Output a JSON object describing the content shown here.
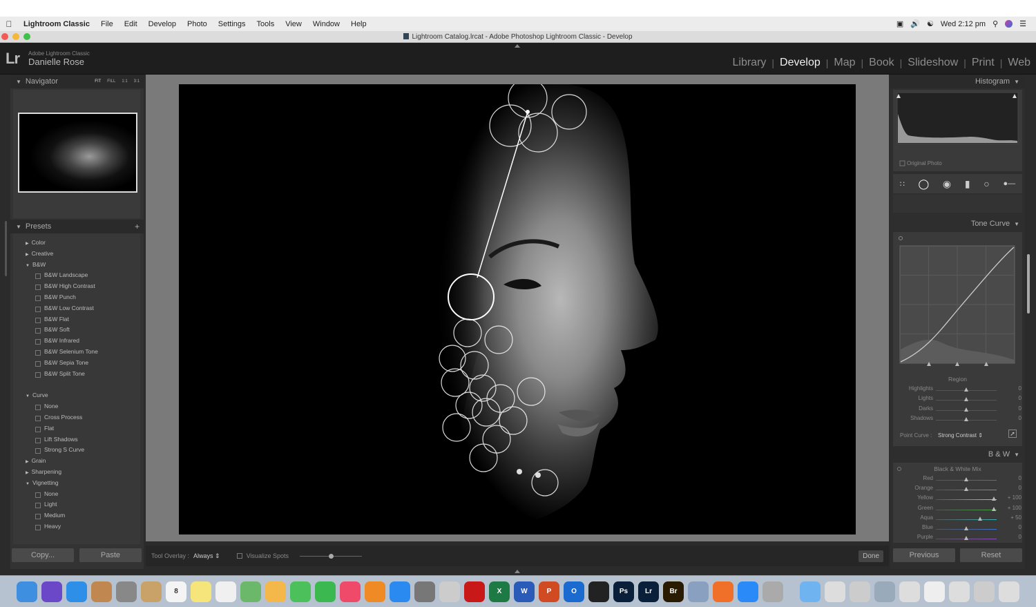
{
  "menubar": {
    "app": "Lightroom Classic",
    "items": [
      "File",
      "Edit",
      "Develop",
      "Photo",
      "Settings",
      "Tools",
      "View",
      "Window",
      "Help"
    ],
    "clock": "Wed 2:12 pm"
  },
  "window": {
    "title": "Lightroom Catalog.lrcat - Adobe Photoshop Lightroom Classic - Develop"
  },
  "identity": {
    "logo": "Lr",
    "product": "Adobe Lightroom Classic",
    "user": "Danielle Rose"
  },
  "modules": [
    "Library",
    "Develop",
    "Map",
    "Book",
    "Slideshow",
    "Print",
    "Web"
  ],
  "active_module": "Develop",
  "navigator": {
    "title": "Navigator",
    "zoom": [
      "FIT",
      "FILL",
      "1:1",
      "3:1"
    ]
  },
  "presets": {
    "title": "Presets",
    "items": [
      {
        "type": "fold",
        "label": "Color",
        "open": false
      },
      {
        "type": "fold",
        "label": "Creative",
        "open": false
      },
      {
        "type": "fold",
        "label": "B&W",
        "open": true
      },
      {
        "type": "item",
        "label": "B&W Landscape"
      },
      {
        "type": "item",
        "label": "B&W High Contrast"
      },
      {
        "type": "item",
        "label": "B&W Punch"
      },
      {
        "type": "item",
        "label": "B&W Low Contrast"
      },
      {
        "type": "item",
        "label": "B&W Flat"
      },
      {
        "type": "item",
        "label": "B&W Soft"
      },
      {
        "type": "item",
        "label": "B&W Infrared"
      },
      {
        "type": "item",
        "label": "B&W Selenium Tone"
      },
      {
        "type": "item",
        "label": "B&W Sepia Tone"
      },
      {
        "type": "item",
        "label": "B&W Split Tone"
      },
      {
        "type": "gap",
        "label": ""
      },
      {
        "type": "fold",
        "label": "Curve",
        "open": true
      },
      {
        "type": "item",
        "label": "None"
      },
      {
        "type": "item",
        "label": "Cross Process"
      },
      {
        "type": "item",
        "label": "Flat"
      },
      {
        "type": "item",
        "label": "Lift Shadows"
      },
      {
        "type": "item",
        "label": "Strong S Curve"
      },
      {
        "type": "fold",
        "label": "Grain",
        "open": false
      },
      {
        "type": "fold",
        "label": "Sharpening",
        "open": false
      },
      {
        "type": "fold",
        "label": "Vignetting",
        "open": true
      },
      {
        "type": "item",
        "label": "None"
      },
      {
        "type": "item",
        "label": "Light"
      },
      {
        "type": "item",
        "label": "Medium"
      },
      {
        "type": "item",
        "label": "Heavy"
      }
    ]
  },
  "left_buttons": {
    "copy": "Copy...",
    "paste": "Paste"
  },
  "toolbar": {
    "overlay_label": "Tool Overlay :",
    "overlay_value": "Always",
    "visualize": "Visualize Spots",
    "done": "Done",
    "visualize_level": 0.5
  },
  "histogram": {
    "title": "Histogram",
    "original": "Original Photo"
  },
  "tone_curve": {
    "title": "Tone Curve",
    "region": "Region",
    "sliders": [
      {
        "label": "Highlights",
        "value": "0",
        "level": 0.5
      },
      {
        "label": "Lights",
        "value": "0",
        "level": 0.5
      },
      {
        "label": "Darks",
        "value": "0",
        "level": 0.5
      },
      {
        "label": "Shadows",
        "value": "0",
        "level": 0.5
      }
    ],
    "point_curve_label": "Point Curve :",
    "point_curve_value": "Strong Contrast"
  },
  "bw": {
    "title": "B & W",
    "mix_title": "Black & White Mix",
    "sliders": [
      {
        "label": "Red",
        "value": "0",
        "color": "#c8453c",
        "level": 0.5
      },
      {
        "label": "Orange",
        "value": "0",
        "color": "#d07a30",
        "level": 0.5
      },
      {
        "label": "Yellow",
        "value": "+ 100",
        "color": "#d6c83a",
        "level": 0.96
      },
      {
        "label": "Green",
        "value": "+ 100",
        "color": "#48a848",
        "level": 0.96
      },
      {
        "label": "Aqua",
        "value": "+ 50",
        "color": "#3fb3b0",
        "level": 0.73
      },
      {
        "label": "Blue",
        "value": "0",
        "color": "#4170c8",
        "level": 0.5
      },
      {
        "label": "Purple",
        "value": "0",
        "color": "#8c4cc0",
        "level": 0.5
      }
    ]
  },
  "right_buttons": {
    "previous": "Previous",
    "reset": "Reset"
  },
  "dock": [
    {
      "name": "finder-icon",
      "color": "#3f8fe0"
    },
    {
      "name": "siri-icon",
      "color": "#6b48c8"
    },
    {
      "name": "safari-icon",
      "color": "#2d8fe8"
    },
    {
      "name": "mail-stamps-icon",
      "color": "#c08850"
    },
    {
      "name": "launchpad-icon",
      "color": "#888"
    },
    {
      "name": "contacts-icon",
      "color": "#c8a268"
    },
    {
      "name": "calendar-icon",
      "color": "#f4f4f4",
      "text": "8"
    },
    {
      "name": "notes-icon",
      "color": "#f6e57a"
    },
    {
      "name": "reminders-icon",
      "color": "#f0f0f0"
    },
    {
      "name": "maps-icon",
      "color": "#6cb86a"
    },
    {
      "name": "photos-icon",
      "color": "#f4b84a"
    },
    {
      "name": "messages-icon",
      "color": "#4cc05a"
    },
    {
      "name": "facetime-icon",
      "color": "#3cb850"
    },
    {
      "name": "music-icon",
      "color": "#f04a6a"
    },
    {
      "name": "books-icon",
      "color": "#f08a24"
    },
    {
      "name": "app-store-icon",
      "color": "#2a8af0"
    },
    {
      "name": "system-preferences-icon",
      "color": "#777"
    },
    {
      "name": "printer-icon",
      "color": "#ccc"
    },
    {
      "name": "acrobat-icon",
      "color": "#c81818"
    },
    {
      "name": "excel-icon",
      "color": "#1e7a44",
      "text": "X"
    },
    {
      "name": "word-icon",
      "color": "#2a5bb8",
      "text": "W"
    },
    {
      "name": "powerpoint-icon",
      "color": "#d04a22",
      "text": "P"
    },
    {
      "name": "outlook-icon",
      "color": "#1a6ad0",
      "text": "O"
    },
    {
      "name": "camera-icon",
      "color": "#222"
    },
    {
      "name": "photoshop-icon",
      "color": "#0a1f3a",
      "text": "Ps"
    },
    {
      "name": "lightroom-icon",
      "color": "#0a1f3a",
      "text": "Lr"
    },
    {
      "name": "bridge-icon",
      "color": "#2a1a00",
      "text": "Br"
    },
    {
      "name": "preview-icon",
      "color": "#8aa0c0"
    },
    {
      "name": "firefox-icon",
      "color": "#f0702a"
    },
    {
      "name": "zoom-icon",
      "color": "#2a8af8"
    },
    {
      "name": "scanner-icon",
      "color": "#aaa"
    },
    {
      "name": "folder-icon",
      "color": "#6fb4f0"
    },
    {
      "name": "image-doc-icon",
      "color": "#ddd"
    },
    {
      "name": "files-icon",
      "color": "#ccc"
    },
    {
      "name": "photos-stack-icon",
      "color": "#9ab"
    },
    {
      "name": "screens-icon",
      "color": "#ddd"
    },
    {
      "name": "docs-icon",
      "color": "#eee"
    },
    {
      "name": "grid-icon",
      "color": "#ddd"
    },
    {
      "name": "window-icon",
      "color": "#ccc"
    },
    {
      "name": "trash-icon",
      "color": "#ddd"
    }
  ]
}
